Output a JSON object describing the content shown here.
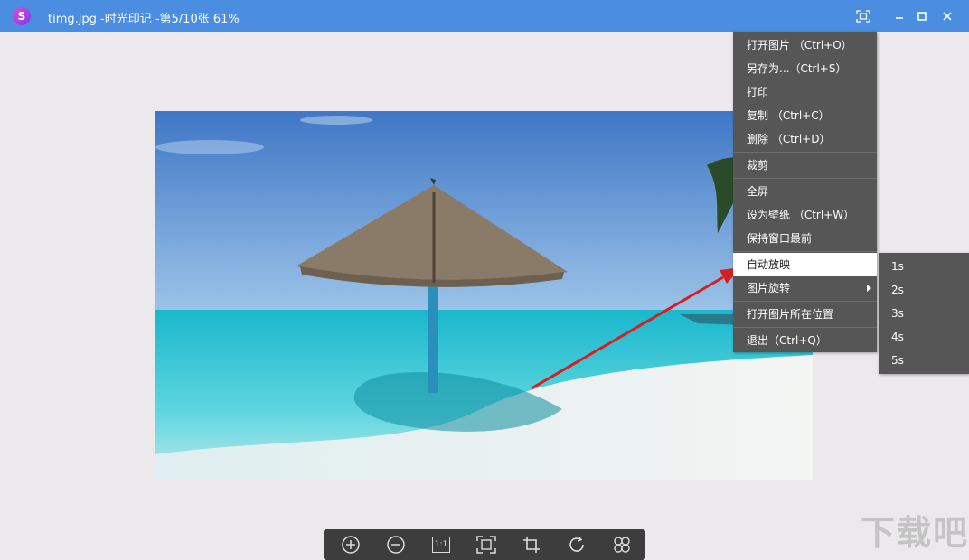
{
  "window": {
    "title": "timg.jpg -时光印记 -第5/10张 61%",
    "logo_letter": "S",
    "controls": [
      "fullscreen-icon",
      "minimize-icon",
      "maximize-icon",
      "close-icon"
    ]
  },
  "context_menu": {
    "items": [
      {
        "label": "打开图片 （Ctrl+O）"
      },
      {
        "label": "另存为...（Ctrl+S）"
      },
      {
        "label": "打印"
      },
      {
        "label": "复制 （Ctrl+C）"
      },
      {
        "label": "删除 （Ctrl+D）"
      },
      {
        "label": "裁剪"
      },
      {
        "label": "全屏"
      },
      {
        "label": "设为壁纸 （Ctrl+W）"
      },
      {
        "label": "保持窗口最前"
      },
      {
        "label": "自动放映"
      },
      {
        "label": "图片旋转"
      },
      {
        "label": "打开图片所在位置"
      },
      {
        "label": "退出（Ctrl+Q）"
      }
    ],
    "highlighted": "自动放映"
  },
  "submenu": {
    "items": [
      "1s",
      "2s",
      "3s",
      "4s",
      "5s"
    ]
  },
  "toolbar": {
    "tools": [
      "zoom-in-icon",
      "zoom-out-icon",
      "actual-size-icon",
      "fit-window-icon",
      "crop-icon",
      "rotate-icon",
      "effects-icon"
    ],
    "actual_size_label": "1:1"
  },
  "watermark": "下载吧",
  "colors": {
    "titlebar": "#4a8de1",
    "menu_bg": "#565656",
    "menu_highlight": "#ffffff",
    "annotation_arrow": "#d42020",
    "toolbar_bg": "#3d3d3d"
  }
}
